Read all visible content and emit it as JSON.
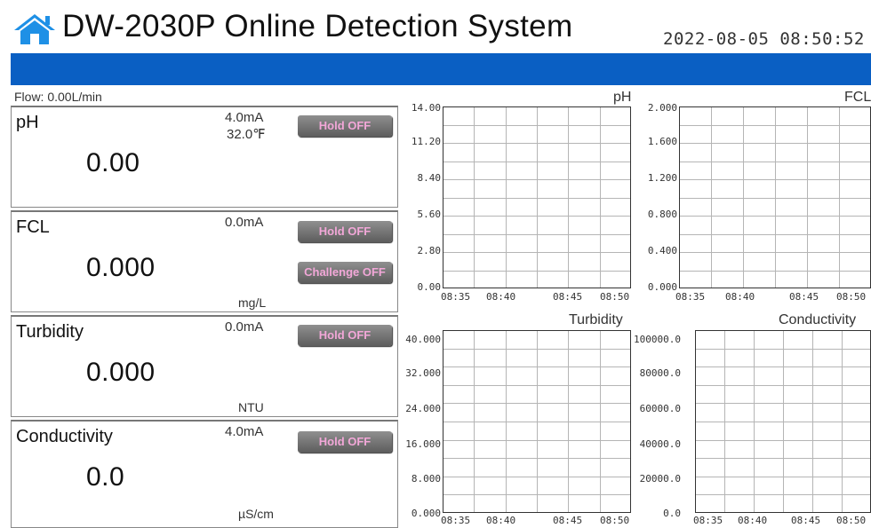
{
  "header": {
    "title": "DW-2030P Online Detection System",
    "datetime": "2022-08-05 08:50:52",
    "home_icon": "home-icon",
    "brand_color": "#0a5fc3"
  },
  "flow": "Flow: 0.00L/min",
  "panels": [
    {
      "name": "pH",
      "ma": "4.0mA",
      "temp": "32.0℉",
      "value": "0.00",
      "unit": "",
      "hold": "Hold OFF"
    },
    {
      "name": "FCL",
      "ma": "0.0mA",
      "value": "0.000",
      "unit": "mg/L",
      "hold": "Hold OFF",
      "challenge": "Challenge OFF"
    },
    {
      "name": "Turbidity",
      "ma": "0.0mA",
      "value": "0.000",
      "unit": "NTU",
      "hold": "Hold OFF"
    },
    {
      "name": "Conductivity",
      "ma": "4.0mA",
      "value": "0.0",
      "unit": "µS/cm",
      "hold": "Hold OFF"
    }
  ],
  "charts": [
    {
      "title": "pH",
      "yticks": [
        "14.00",
        "11.20",
        "8.40",
        "5.60",
        "2.80",
        "0.00"
      ],
      "xticks": [
        "08:35",
        "08:40",
        "08:45",
        "08:50"
      ]
    },
    {
      "title": "FCL",
      "yticks": [
        "2.000",
        "1.600",
        "1.200",
        "0.800",
        "0.400",
        "0.000"
      ],
      "xticks": [
        "08:35",
        "08:40",
        "08:45",
        "08:50"
      ]
    },
    {
      "title": "Turbidity",
      "yticks": [
        "40.000",
        "32.000",
        "24.000",
        "16.000",
        "8.000",
        "0.000"
      ],
      "xticks": [
        "08:35",
        "08:40",
        "08:45",
        "08:50"
      ]
    },
    {
      "title": "Conductivity",
      "yticks": [
        "100000.0",
        "80000.0",
        "60000.0",
        "40000.0",
        "20000.0",
        "0.0"
      ],
      "xticks": [
        "08:35",
        "08:40",
        "08:45",
        "08:50"
      ]
    }
  ]
}
